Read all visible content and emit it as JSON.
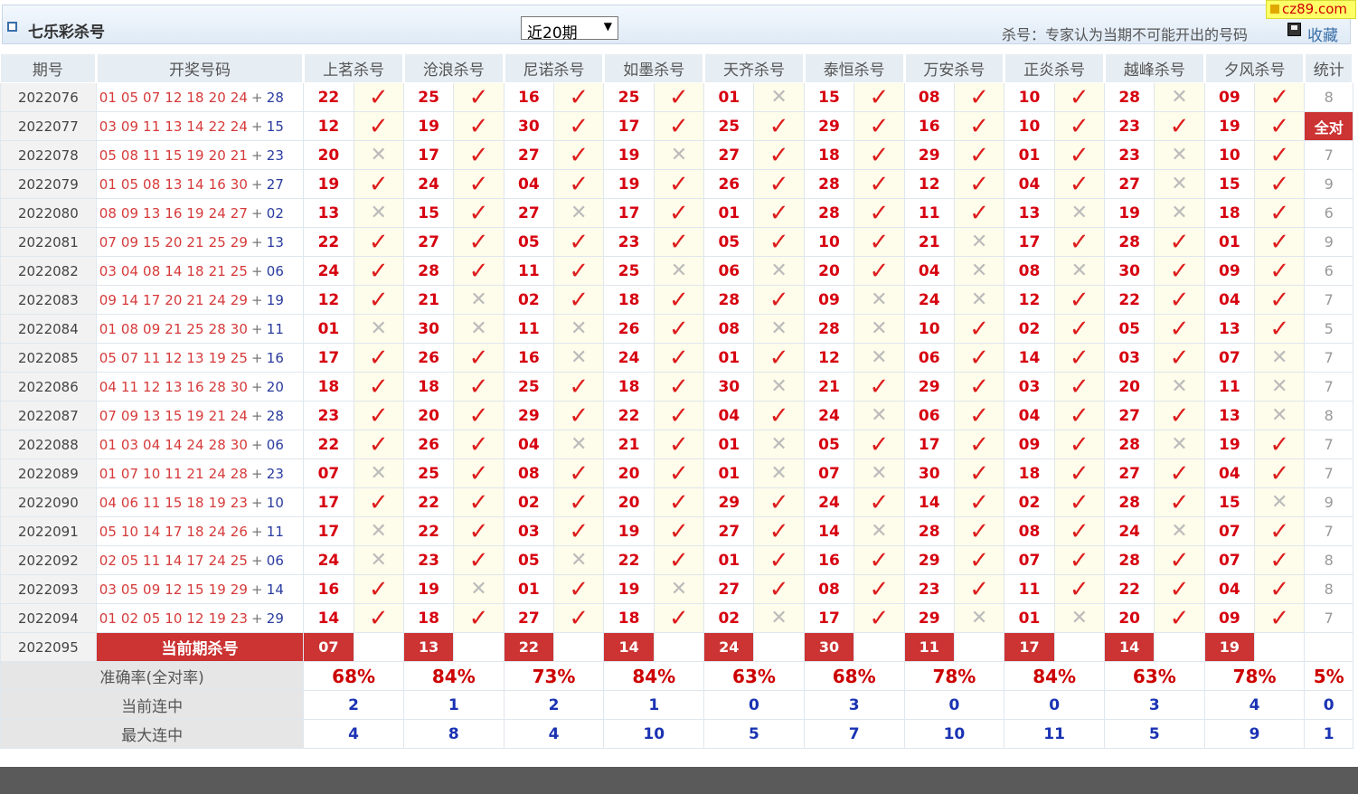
{
  "header": {
    "title": "七乐彩杀号",
    "period_select": "近20期",
    "tip": "杀号：专家认为当期不可能开出的号码",
    "save": "收藏",
    "site": "cz89.com"
  },
  "columns": {
    "period": "期号",
    "draw": "开奖号码",
    "experts": [
      "上茗杀号",
      "沧浪杀号",
      "尼诺杀号",
      "如墨杀号",
      "天齐杀号",
      "泰恒杀号",
      "万安杀号",
      "正炎杀号",
      "越峰杀号",
      "夕风杀号"
    ],
    "stat": "统计"
  },
  "rows": [
    {
      "period": "2022076",
      "draw": [
        "01",
        "05",
        "07",
        "12",
        "18",
        "20",
        "24"
      ],
      "special": "28",
      "picks": [
        "22",
        "25",
        "16",
        "25",
        "01",
        "15",
        "08",
        "10",
        "28",
        "09"
      ],
      "hits": [
        1,
        1,
        1,
        1,
        0,
        1,
        1,
        1,
        0,
        1
      ],
      "stat": "8"
    },
    {
      "period": "2022077",
      "draw": [
        "03",
        "09",
        "11",
        "13",
        "14",
        "22",
        "24"
      ],
      "special": "15",
      "picks": [
        "12",
        "19",
        "30",
        "17",
        "25",
        "29",
        "16",
        "10",
        "23",
        "19"
      ],
      "hits": [
        1,
        1,
        1,
        1,
        1,
        1,
        1,
        1,
        1,
        1
      ],
      "stat": "全对"
    },
    {
      "period": "2022078",
      "draw": [
        "05",
        "08",
        "11",
        "15",
        "19",
        "20",
        "21"
      ],
      "special": "23",
      "picks": [
        "20",
        "17",
        "27",
        "19",
        "27",
        "18",
        "29",
        "01",
        "23",
        "10"
      ],
      "hits": [
        0,
        1,
        1,
        0,
        1,
        1,
        1,
        1,
        0,
        1
      ],
      "stat": "7"
    },
    {
      "period": "2022079",
      "draw": [
        "01",
        "05",
        "08",
        "13",
        "14",
        "16",
        "30"
      ],
      "special": "27",
      "picks": [
        "19",
        "24",
        "04",
        "19",
        "26",
        "28",
        "12",
        "04",
        "27",
        "15"
      ],
      "hits": [
        1,
        1,
        1,
        1,
        1,
        1,
        1,
        1,
        0,
        1
      ],
      "stat": "9"
    },
    {
      "period": "2022080",
      "draw": [
        "08",
        "09",
        "13",
        "16",
        "19",
        "24",
        "27"
      ],
      "special": "02",
      "picks": [
        "13",
        "15",
        "27",
        "17",
        "01",
        "28",
        "11",
        "13",
        "19",
        "18"
      ],
      "hits": [
        0,
        1,
        0,
        1,
        1,
        1,
        1,
        0,
        0,
        1
      ],
      "stat": "6"
    },
    {
      "period": "2022081",
      "draw": [
        "07",
        "09",
        "15",
        "20",
        "21",
        "25",
        "29"
      ],
      "special": "13",
      "picks": [
        "22",
        "27",
        "05",
        "23",
        "05",
        "10",
        "21",
        "17",
        "28",
        "01"
      ],
      "hits": [
        1,
        1,
        1,
        1,
        1,
        1,
        0,
        1,
        1,
        1
      ],
      "stat": "9"
    },
    {
      "period": "2022082",
      "draw": [
        "03",
        "04",
        "08",
        "14",
        "18",
        "21",
        "25"
      ],
      "special": "06",
      "picks": [
        "24",
        "28",
        "11",
        "25",
        "06",
        "20",
        "04",
        "08",
        "30",
        "09"
      ],
      "hits": [
        1,
        1,
        1,
        0,
        0,
        1,
        0,
        0,
        1,
        1
      ],
      "stat": "6"
    },
    {
      "period": "2022083",
      "draw": [
        "09",
        "14",
        "17",
        "20",
        "21",
        "24",
        "29"
      ],
      "special": "19",
      "picks": [
        "12",
        "21",
        "02",
        "18",
        "28",
        "09",
        "24",
        "12",
        "22",
        "04"
      ],
      "hits": [
        1,
        0,
        1,
        1,
        1,
        0,
        0,
        1,
        1,
        1
      ],
      "stat": "7"
    },
    {
      "period": "2022084",
      "draw": [
        "01",
        "08",
        "09",
        "21",
        "25",
        "28",
        "30"
      ],
      "special": "11",
      "picks": [
        "01",
        "30",
        "11",
        "26",
        "08",
        "28",
        "10",
        "02",
        "05",
        "13"
      ],
      "hits": [
        0,
        0,
        0,
        1,
        0,
        0,
        1,
        1,
        1,
        1
      ],
      "stat": "5"
    },
    {
      "period": "2022085",
      "draw": [
        "05",
        "07",
        "11",
        "12",
        "13",
        "19",
        "25"
      ],
      "special": "16",
      "picks": [
        "17",
        "26",
        "16",
        "24",
        "01",
        "12",
        "06",
        "14",
        "03",
        "07"
      ],
      "hits": [
        1,
        1,
        0,
        1,
        1,
        0,
        1,
        1,
        1,
        0
      ],
      "stat": "7"
    },
    {
      "period": "2022086",
      "draw": [
        "04",
        "11",
        "12",
        "13",
        "16",
        "28",
        "30"
      ],
      "special": "20",
      "picks": [
        "18",
        "18",
        "25",
        "18",
        "30",
        "21",
        "29",
        "03",
        "20",
        "11"
      ],
      "hits": [
        1,
        1,
        1,
        1,
        0,
        1,
        1,
        1,
        0,
        0
      ],
      "stat": "7"
    },
    {
      "period": "2022087",
      "draw": [
        "07",
        "09",
        "13",
        "15",
        "19",
        "21",
        "24"
      ],
      "special": "28",
      "picks": [
        "23",
        "20",
        "29",
        "22",
        "04",
        "24",
        "06",
        "04",
        "27",
        "13"
      ],
      "hits": [
        1,
        1,
        1,
        1,
        1,
        0,
        1,
        1,
        1,
        0
      ],
      "stat": "8"
    },
    {
      "period": "2022088",
      "draw": [
        "01",
        "03",
        "04",
        "14",
        "24",
        "28",
        "30"
      ],
      "special": "06",
      "picks": [
        "22",
        "26",
        "04",
        "21",
        "01",
        "05",
        "17",
        "09",
        "28",
        "19"
      ],
      "hits": [
        1,
        1,
        0,
        1,
        0,
        1,
        1,
        1,
        0,
        1
      ],
      "stat": "7"
    },
    {
      "period": "2022089",
      "draw": [
        "01",
        "07",
        "10",
        "11",
        "21",
        "24",
        "28"
      ],
      "special": "23",
      "picks": [
        "07",
        "25",
        "08",
        "20",
        "01",
        "07",
        "30",
        "18",
        "27",
        "04"
      ],
      "hits": [
        0,
        1,
        1,
        1,
        0,
        0,
        1,
        1,
        1,
        1
      ],
      "stat": "7"
    },
    {
      "period": "2022090",
      "draw": [
        "04",
        "06",
        "11",
        "15",
        "18",
        "19",
        "23"
      ],
      "special": "10",
      "picks": [
        "17",
        "22",
        "02",
        "20",
        "29",
        "24",
        "14",
        "02",
        "28",
        "15"
      ],
      "hits": [
        1,
        1,
        1,
        1,
        1,
        1,
        1,
        1,
        1,
        0
      ],
      "stat": "9"
    },
    {
      "period": "2022091",
      "draw": [
        "05",
        "10",
        "14",
        "17",
        "18",
        "24",
        "26"
      ],
      "special": "11",
      "picks": [
        "17",
        "22",
        "03",
        "19",
        "27",
        "14",
        "28",
        "08",
        "24",
        "07"
      ],
      "hits": [
        0,
        1,
        1,
        1,
        1,
        0,
        1,
        1,
        0,
        1
      ],
      "stat": "7"
    },
    {
      "period": "2022092",
      "draw": [
        "02",
        "05",
        "11",
        "14",
        "17",
        "24",
        "25"
      ],
      "special": "06",
      "picks": [
        "24",
        "23",
        "05",
        "22",
        "01",
        "16",
        "29",
        "07",
        "28",
        "07"
      ],
      "hits": [
        0,
        1,
        0,
        1,
        1,
        1,
        1,
        1,
        1,
        1
      ],
      "stat": "8"
    },
    {
      "period": "2022093",
      "draw": [
        "03",
        "05",
        "09",
        "12",
        "15",
        "19",
        "29"
      ],
      "special": "14",
      "picks": [
        "16",
        "19",
        "01",
        "19",
        "27",
        "08",
        "23",
        "11",
        "22",
        "04"
      ],
      "hits": [
        1,
        0,
        1,
        0,
        1,
        1,
        1,
        1,
        1,
        1
      ],
      "stat": "8"
    },
    {
      "period": "2022094",
      "draw": [
        "01",
        "02",
        "05",
        "10",
        "12",
        "19",
        "23"
      ],
      "special": "29",
      "picks": [
        "14",
        "18",
        "27",
        "18",
        "02",
        "17",
        "29",
        "01",
        "20",
        "09"
      ],
      "hits": [
        1,
        1,
        1,
        1,
        0,
        1,
        0,
        0,
        1,
        1
      ],
      "stat": "7"
    }
  ],
  "current": {
    "period": "2022095",
    "label": "当前期杀号",
    "picks": [
      "07",
      "13",
      "22",
      "14",
      "24",
      "30",
      "11",
      "17",
      "14",
      "19"
    ]
  },
  "summary": {
    "accuracy_label": "准确率(全对率)",
    "accuracy": [
      "68%",
      "84%",
      "73%",
      "84%",
      "63%",
      "68%",
      "78%",
      "84%",
      "63%",
      "78%"
    ],
    "accuracy_full": "5%",
    "streak_label": "当前连中",
    "streak": [
      "2",
      "1",
      "2",
      "1",
      "0",
      "3",
      "0",
      "0",
      "3",
      "4"
    ],
    "streak_total": "0",
    "max_label": "最大连中",
    "max": [
      "4",
      "8",
      "4",
      "10",
      "5",
      "7",
      "10",
      "11",
      "5",
      "9"
    ],
    "max_total": "1"
  },
  "icons": {
    "hit": "check-icon",
    "miss": "cross-icon"
  }
}
